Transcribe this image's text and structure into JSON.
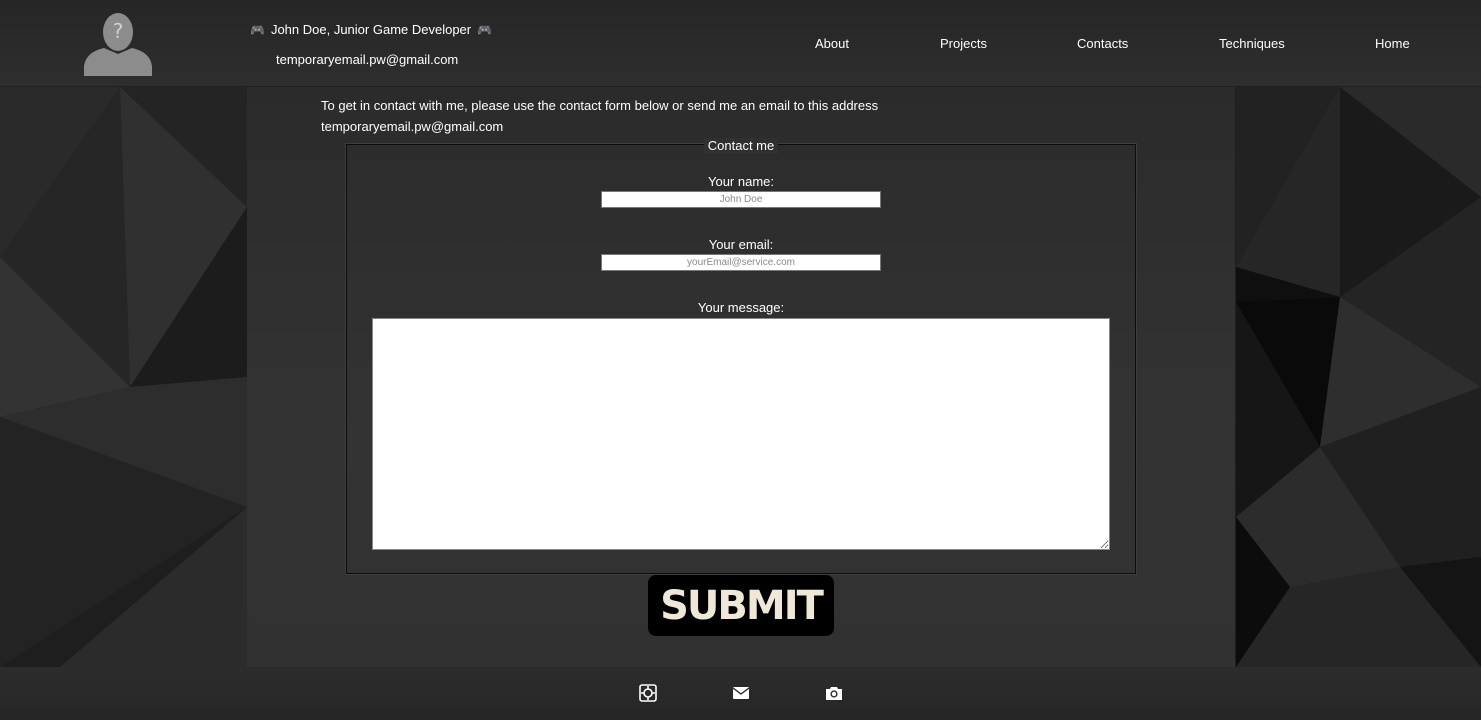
{
  "header": {
    "title": "John Doe, Junior Game Developer",
    "email": "temporaryemail.pw@gmail.com",
    "avatar_icon": "unknown-user-avatar",
    "decor_icon": "gamepad-icon",
    "decor_glyph": "🎮"
  },
  "nav": {
    "items": [
      {
        "label": "About"
      },
      {
        "label": "Projects"
      },
      {
        "label": "Contacts"
      },
      {
        "label": "Techniques"
      },
      {
        "label": "Home"
      }
    ]
  },
  "intro": {
    "line1": "To get in contact with me, please use the contact form below or send me an email to this address",
    "email": "temporaryemail.pw@gmail.com"
  },
  "form": {
    "legend": "Contact me",
    "name_label": "Your name:",
    "name_placeholder": "John Doe",
    "email_label": "Your email:",
    "email_placeholder": "yourEmail@service.com",
    "message_label": "Your message:",
    "submit_label": "SUBMIT"
  },
  "footer": {
    "icons": [
      "itch-io-icon",
      "mail-icon",
      "camera-icon"
    ]
  },
  "colors": {
    "header_bg": "#2a2a2a",
    "main_bg": "#313131",
    "submit_bg": "#000000",
    "submit_text": "#efe8d8"
  }
}
